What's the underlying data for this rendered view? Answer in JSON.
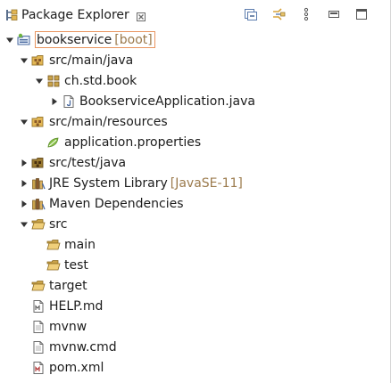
{
  "view": {
    "title": "Package Explorer",
    "icons": {
      "view": "package-explorer-icon",
      "close": "close-icon",
      "collapse_all": "collapse-all-icon",
      "link_with_editor": "link-with-editor-icon",
      "view_menu": "view-menu-icon",
      "minimize": "minimize-icon",
      "maximize": "maximize-icon"
    }
  },
  "tree": {
    "project": {
      "label": "bookservice",
      "decoration": "[boot]"
    },
    "src_main_java": {
      "label": "src/main/java"
    },
    "package": {
      "label": "ch.std.book"
    },
    "app_class": {
      "label": "BookserviceApplication.java"
    },
    "src_main_resources": {
      "label": "src/main/resources"
    },
    "app_props": {
      "label": "application.properties"
    },
    "src_test_java": {
      "label": "src/test/java"
    },
    "jre": {
      "label": "JRE System Library",
      "decoration": "[JavaSE-11]"
    },
    "maven": {
      "label": "Maven Dependencies"
    },
    "src": {
      "label": "src"
    },
    "main": {
      "label": "main"
    },
    "test": {
      "label": "test"
    },
    "target": {
      "label": "target"
    },
    "help": {
      "label": "HELP.md"
    },
    "mvnw": {
      "label": "mvnw"
    },
    "mvnw_cmd": {
      "label": "mvnw.cmd"
    },
    "pom": {
      "label": "pom.xml"
    }
  },
  "colors": {
    "selection_border": "#e8955f",
    "decoration_text": "#9b7a4c",
    "folder": "#e2b654",
    "package_source": "#b88a3a",
    "twisty": "#333333"
  }
}
